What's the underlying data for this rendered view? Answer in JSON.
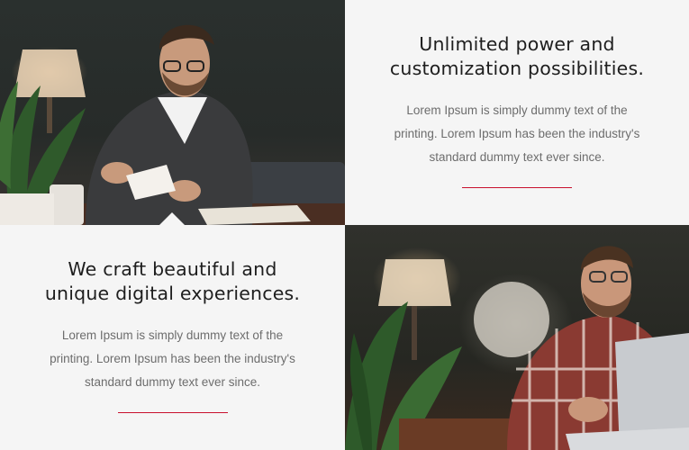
{
  "sections": [
    {
      "heading_line1": "Unlimited power and",
      "heading_line2": "customization possibilities.",
      "body_line1": "Lorem Ipsum is simply dummy text of the",
      "body_line2": "printing. Lorem Ipsum has been the industry's",
      "body_line3": "standard dummy text ever since."
    },
    {
      "heading_line1": "We craft beautiful and",
      "heading_line2": "unique digital experiences.",
      "body_line1": "Lorem Ipsum is simply dummy text of the",
      "body_line2": "printing. Lorem Ipsum has been the industry's",
      "body_line3": "standard dummy text ever since."
    }
  ],
  "colors": {
    "accent_rule": "#c8102e",
    "background": "#f5f5f5",
    "heading": "#1e1e1e",
    "body": "#6d6d6d"
  }
}
